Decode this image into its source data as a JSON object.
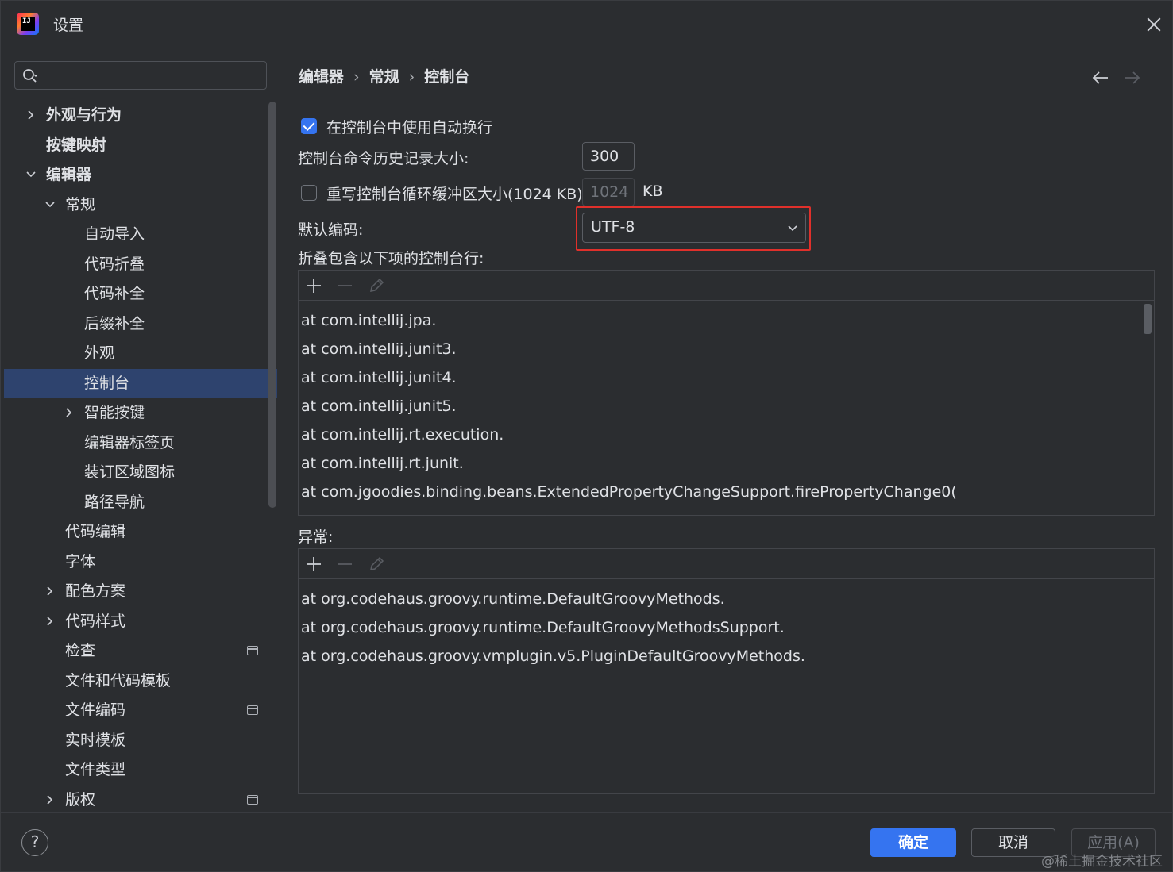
{
  "window": {
    "title": "设置",
    "logo_text": "IJ"
  },
  "search": {
    "placeholder": ""
  },
  "tree": [
    {
      "label": "外观与行为",
      "level": 0,
      "chevron": "right",
      "bold": true
    },
    {
      "label": "按键映射",
      "level": 0,
      "chevron": "none",
      "bold": true
    },
    {
      "label": "编辑器",
      "level": 0,
      "chevron": "down",
      "bold": true
    },
    {
      "label": "常规",
      "level": 1,
      "chevron": "down"
    },
    {
      "label": "自动导入",
      "level": 2,
      "chevron": "none"
    },
    {
      "label": "代码折叠",
      "level": 2,
      "chevron": "none"
    },
    {
      "label": "代码补全",
      "level": 2,
      "chevron": "none"
    },
    {
      "label": "后缀补全",
      "level": 2,
      "chevron": "none"
    },
    {
      "label": "外观",
      "level": 2,
      "chevron": "none"
    },
    {
      "label": "控制台",
      "level": 2,
      "chevron": "none",
      "selected": true
    },
    {
      "label": "智能按键",
      "level": 2,
      "chevron": "right"
    },
    {
      "label": "编辑器标签页",
      "level": 2,
      "chevron": "none"
    },
    {
      "label": "装订区域图标",
      "level": 2,
      "chevron": "none"
    },
    {
      "label": "路径导航",
      "level": 2,
      "chevron": "none"
    },
    {
      "label": "代码编辑",
      "level": 1,
      "chevron": "none"
    },
    {
      "label": "字体",
      "level": 1,
      "chevron": "none"
    },
    {
      "label": "配色方案",
      "level": 1,
      "chevron": "right"
    },
    {
      "label": "代码样式",
      "level": 1,
      "chevron": "right"
    },
    {
      "label": "检查",
      "level": 1,
      "chevron": "none",
      "badge": true
    },
    {
      "label": "文件和代码模板",
      "level": 1,
      "chevron": "none"
    },
    {
      "label": "文件编码",
      "level": 1,
      "chevron": "none",
      "badge": true
    },
    {
      "label": "实时模板",
      "level": 1,
      "chevron": "none"
    },
    {
      "label": "文件类型",
      "level": 1,
      "chevron": "none"
    },
    {
      "label": "版权",
      "level": 1,
      "chevron": "right",
      "badge": true
    }
  ],
  "breadcrumb": {
    "items": [
      "编辑器",
      "常规",
      "控制台"
    ],
    "separator": "›"
  },
  "settings": {
    "soft_wrap_label": "在控制台中使用自动换行",
    "soft_wrap_checked": true,
    "history_label": "控制台命令历史记录大小:",
    "history_value": "300",
    "buffer_label": "重写控制台循环缓冲区大小(1024 KB)",
    "buffer_checked": false,
    "buffer_value": "1024",
    "buffer_unit": "KB",
    "encoding_label": "默认编码:",
    "encoding_value": "UTF-8",
    "fold_label": "折叠包含以下项的控制台行:",
    "fold_lines": [
      "at com.intellij.jpa.",
      "at com.intellij.junit3.",
      "at com.intellij.junit4.",
      "at com.intellij.junit5.",
      "at com.intellij.rt.execution.",
      "at com.intellij.rt.junit.",
      "at com.jgoodies.binding.beans.ExtendedPropertyChangeSupport.firePropertyChange0("
    ],
    "exceptions_label": "异常:",
    "exception_lines": [
      "at org.codehaus.groovy.runtime.DefaultGroovyMethods.",
      "at org.codehaus.groovy.runtime.DefaultGroovyMethodsSupport.",
      "at org.codehaus.groovy.vmplugin.v5.PluginDefaultGroovyMethods."
    ]
  },
  "footer": {
    "help": "?",
    "ok": "确定",
    "cancel": "取消",
    "apply": "应用(A)",
    "watermark": "@稀土掘金技术社区"
  },
  "colors": {
    "accent": "#3574f0",
    "selection": "#2e436e",
    "highlight_frame": "#e0302b",
    "background": "#2b2d30"
  }
}
